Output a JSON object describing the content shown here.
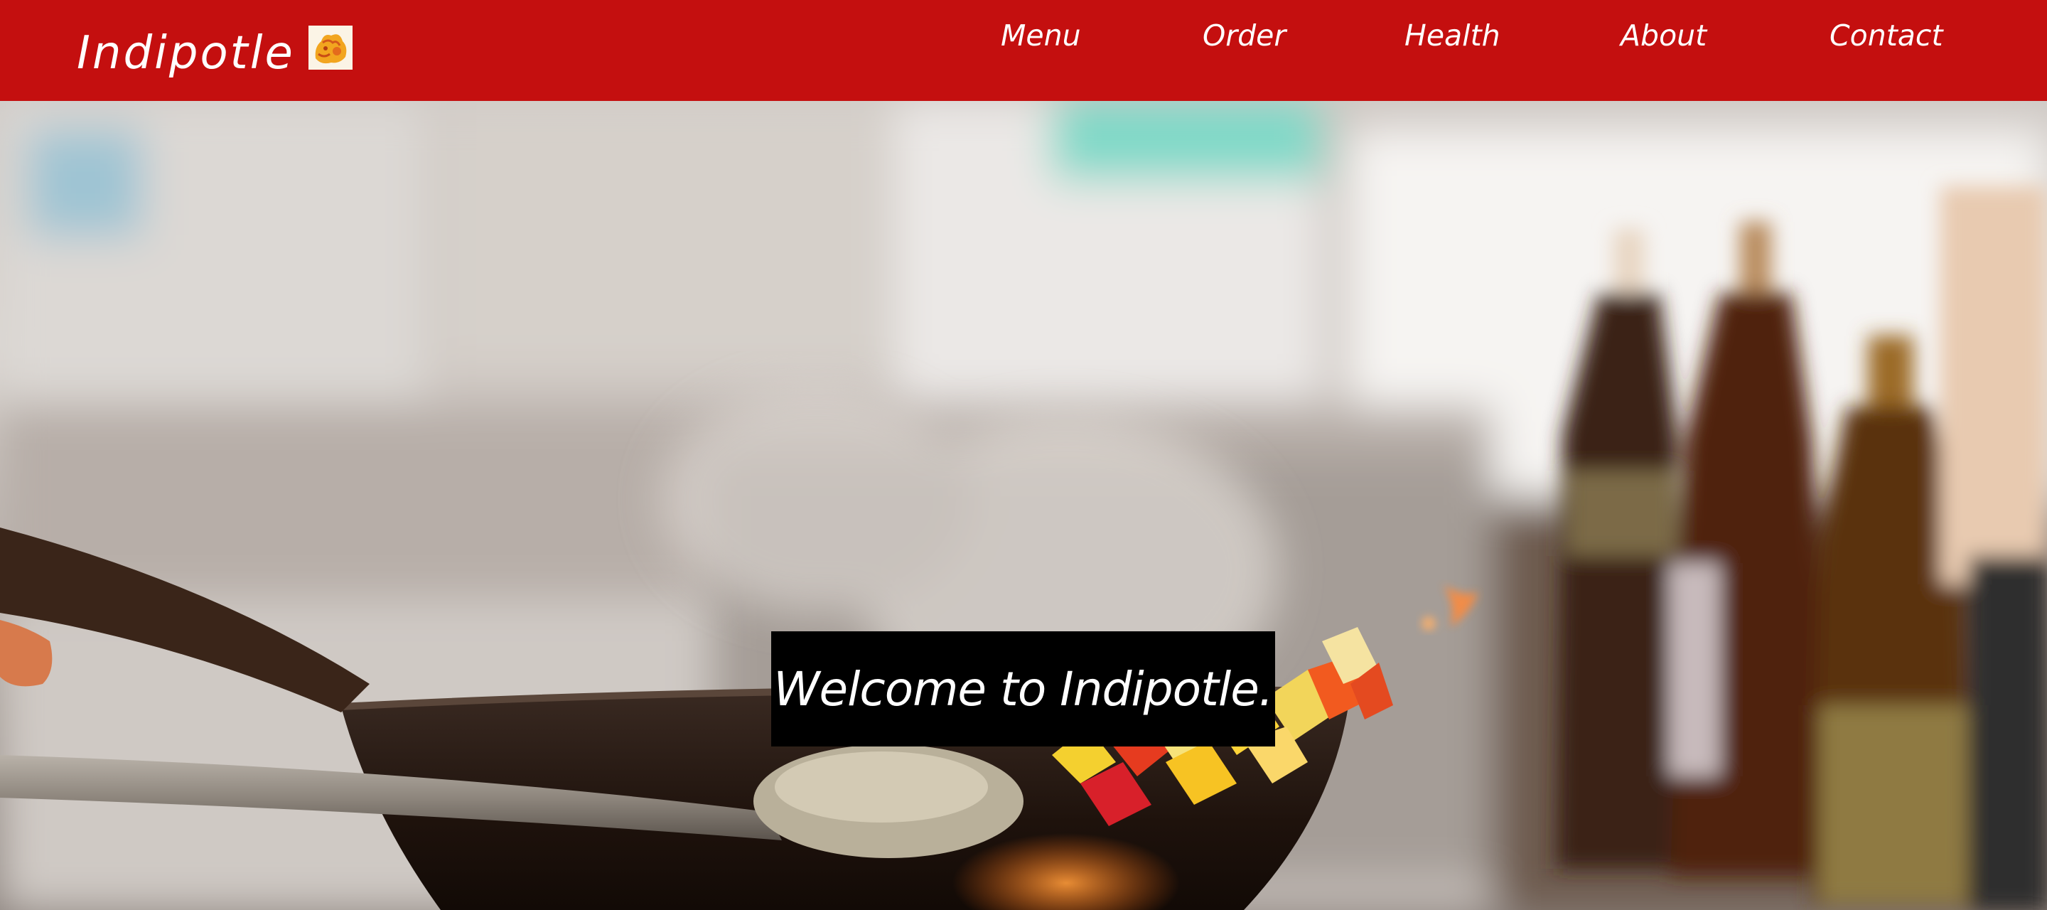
{
  "brand": {
    "name": "Indipotle",
    "logo_icon": "chef-logo-icon"
  },
  "nav": {
    "items": [
      {
        "label": "Menu"
      },
      {
        "label": "Order"
      },
      {
        "label": "Health"
      },
      {
        "label": "About"
      },
      {
        "label": "Contact"
      }
    ]
  },
  "hero": {
    "welcome": "Welcome to Indipotle.",
    "background_image": "kitchen-wok-photo"
  },
  "colors": {
    "navbar": "#c40f0f",
    "text": "#ffffff",
    "welcome_box": "#000000"
  }
}
